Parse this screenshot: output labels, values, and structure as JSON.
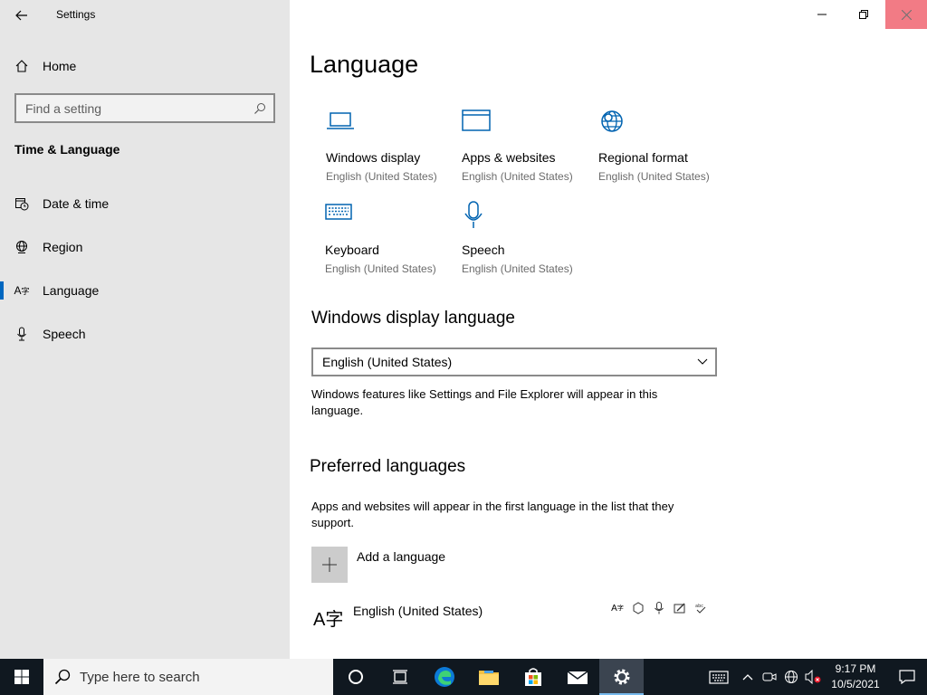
{
  "window": {
    "title": "Settings"
  },
  "sidebar": {
    "home_label": "Home",
    "search_placeholder": "Find a setting",
    "section_title": "Time & Language",
    "items": [
      {
        "label": "Date & time",
        "icon": "calendar-clock-icon",
        "active": false
      },
      {
        "label": "Region",
        "icon": "globe-icon",
        "active": false
      },
      {
        "label": "Language",
        "icon": "language-icon",
        "active": true
      },
      {
        "label": "Speech",
        "icon": "microphone-icon",
        "active": false
      }
    ]
  },
  "main": {
    "title": "Language",
    "tiles": [
      {
        "label": "Windows display",
        "sub": "English (United States)",
        "icon": "laptop-icon"
      },
      {
        "label": "Apps & websites",
        "sub": "English (United States)",
        "icon": "browser-window-icon"
      },
      {
        "label": "Regional format",
        "sub": "English (United States)",
        "icon": "globe-gear-icon"
      },
      {
        "label": "Keyboard",
        "sub": "English (United States)",
        "icon": "keyboard-icon"
      },
      {
        "label": "Speech",
        "sub": "English (United States)",
        "icon": "microphone-icon"
      }
    ],
    "display_language": {
      "heading": "Windows display language",
      "selected": "English (United States)",
      "description": "Windows features like Settings and File Explorer will appear in this language."
    },
    "preferred": {
      "heading": "Preferred languages",
      "description": "Apps and websites will appear in the first language in the list that they support.",
      "add_label": "Add a language",
      "languages": [
        {
          "name": "English (United States)",
          "glyph": "A字"
        }
      ]
    }
  },
  "taskbar": {
    "search_placeholder": "Type here to search",
    "clock_time": "9:17 PM",
    "clock_date": "10/5/2021"
  },
  "colors": {
    "accent": "#0067c0",
    "icon_blue": "#0063b1",
    "sidebar_bg": "#e6e6e6",
    "taskbar_bg": "#101820"
  }
}
